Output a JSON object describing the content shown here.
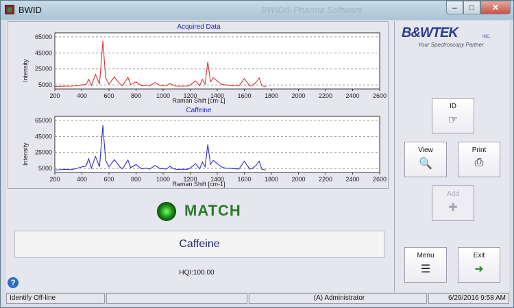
{
  "window": {
    "title": "BWID",
    "background_title": "BWID® Pharma Software"
  },
  "charts": [
    {
      "title": "Acquired Data",
      "color": "#e03030",
      "ylabel": "Intensity",
      "xlabel": "Raman Shift [cm-1]",
      "xticks": [
        "200",
        "400",
        "600",
        "800",
        "1000",
        "1200",
        "1400",
        "1600",
        "1800",
        "2000",
        "2200",
        "2400",
        "2600"
      ],
      "yticks": [
        "65000",
        "45000",
        "25000",
        "5000"
      ]
    },
    {
      "title": "Caffeine",
      "color": "#2b2bd0",
      "ylabel": "Intensity",
      "xlabel": "Raman Shift [cm-1]",
      "xticks": [
        "200",
        "400",
        "600",
        "800",
        "1000",
        "1200",
        "1400",
        "1600",
        "1800",
        "2000",
        "2200",
        "2400",
        "2600"
      ],
      "yticks": [
        "65000",
        "45000",
        "25000",
        "5000"
      ]
    }
  ],
  "chart_data": [
    {
      "type": "line",
      "title": "Acquired Data",
      "xlabel": "Raman Shift [cm-1]",
      "ylabel": "Intensity",
      "xlim": [
        200,
        2600
      ],
      "ylim": [
        0,
        70000
      ],
      "grid": true,
      "x": [
        200,
        240,
        280,
        320,
        360,
        400,
        430,
        450,
        470,
        500,
        530,
        555,
        575,
        600,
        640,
        680,
        700,
        740,
        760,
        800,
        840,
        880,
        900,
        940,
        980,
        1000,
        1020,
        1050,
        1080,
        1100,
        1140,
        1180,
        1200,
        1240,
        1270,
        1290,
        1310,
        1330,
        1350,
        1370,
        1400,
        1430,
        1460,
        1500,
        1560,
        1600,
        1640,
        1660,
        1690,
        1710,
        1730,
        1760
      ],
      "series": [
        {
          "values": [
            3000,
            3200,
            3600,
            3400,
            4200,
            5000,
            5500,
            12000,
            4500,
            18000,
            6000,
            60000,
            14000,
            6000,
            15000,
            6500,
            4000,
            14500,
            5500,
            9000,
            4000,
            4800,
            3800,
            8000,
            4200,
            4500,
            3600,
            7000,
            4000,
            3400,
            3500,
            3600,
            5000,
            10000,
            4000,
            12000,
            6000,
            34000,
            9000,
            14000,
            10000,
            6000,
            5000,
            4500,
            3800,
            13000,
            3800,
            4500,
            9000,
            14000,
            3800,
            3000
          ]
        }
      ]
    },
    {
      "type": "line",
      "title": "Caffeine",
      "xlabel": "Raman Shift [cm-1]",
      "ylabel": "Intensity",
      "xlim": [
        200,
        2600
      ],
      "ylim": [
        0,
        70000
      ],
      "grid": true,
      "x": [
        200,
        240,
        280,
        320,
        360,
        400,
        430,
        450,
        470,
        500,
        530,
        555,
        575,
        600,
        640,
        680,
        700,
        740,
        760,
        800,
        840,
        880,
        900,
        940,
        980,
        1000,
        1020,
        1050,
        1080,
        1100,
        1140,
        1180,
        1200,
        1240,
        1270,
        1290,
        1310,
        1330,
        1350,
        1370,
        1400,
        1430,
        1460,
        1500,
        1560,
        1600,
        1640,
        1660,
        1690,
        1710,
        1730,
        1760
      ],
      "series": [
        {
          "values": [
            3000,
            3500,
            4000,
            3500,
            5000,
            7000,
            8000,
            17000,
            5500,
            20000,
            7000,
            59000,
            15000,
            7000,
            16000,
            7000,
            4500,
            15500,
            6000,
            10000,
            4500,
            5500,
            4000,
            9000,
            4500,
            5000,
            4000,
            7500,
            4500,
            3800,
            4000,
            4000,
            5500,
            11000,
            4500,
            13000,
            7000,
            35000,
            10000,
            15000,
            11000,
            7000,
            5500,
            5000,
            4200,
            14000,
            4200,
            5000,
            9500,
            14000,
            4000,
            3000
          ]
        }
      ]
    }
  ],
  "result": {
    "status": "MATCH",
    "compound": "Caffeine",
    "hqi": "HQI:100.00"
  },
  "logo": {
    "brand": "B&WTEK",
    "inc": "INC.",
    "tagline": "Your Spectroscopy Partner"
  },
  "buttons": {
    "id": "ID",
    "view": "View",
    "print": "Print",
    "add": "Add",
    "menu": "Menu",
    "exit": "Exit"
  },
  "status": {
    "mode": "Identify Off-line",
    "user": "(A) Administrator",
    "datetime": "6/29/2016  9:58 AM"
  },
  "help_icon": "?"
}
